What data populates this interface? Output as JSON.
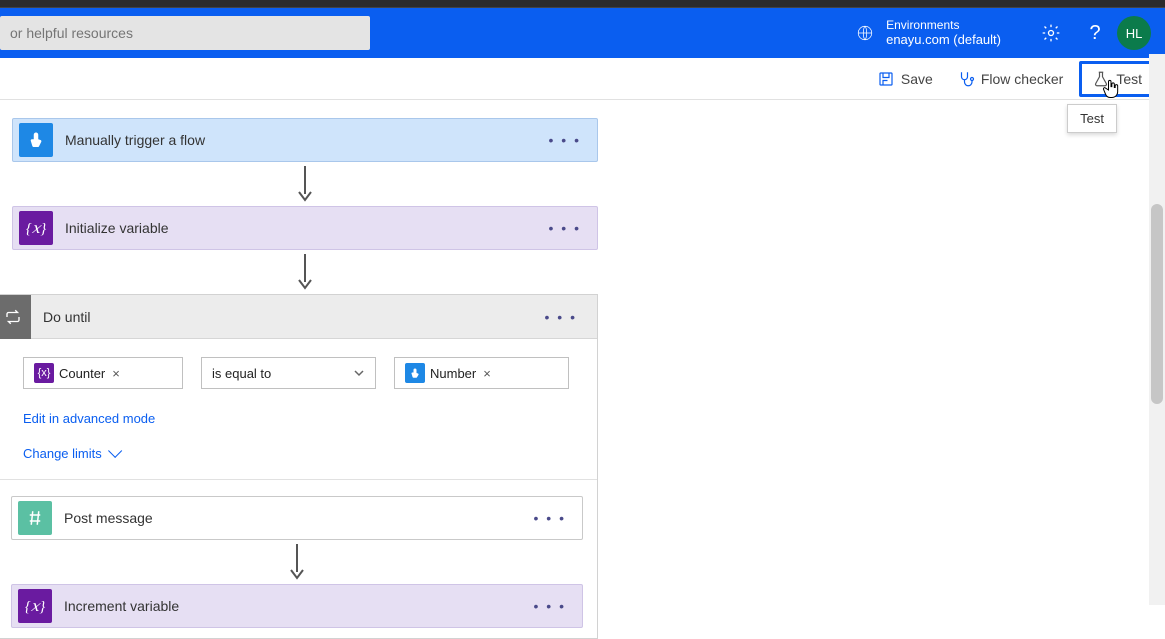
{
  "header": {
    "search_placeholder": "or helpful resources",
    "env_label": "Environments",
    "env_name": "enayu.com (default)",
    "avatar_initials": "HL"
  },
  "toolbar": {
    "save_label": "Save",
    "flowchecker_label": "Flow checker",
    "test_label": "Test",
    "tooltip_test": "Test"
  },
  "flow": {
    "trigger": {
      "title": "Manually trigger a flow"
    },
    "init": {
      "title": "Initialize variable"
    },
    "dountil": {
      "title": "Do until",
      "condition": {
        "left_chip": "Counter",
        "operator": "is equal to",
        "right_chip": "Number"
      },
      "advanced_link": "Edit in advanced mode",
      "limits_link": "Change limits",
      "inner_post": "Post message",
      "inner_inc": "Increment variable"
    }
  }
}
